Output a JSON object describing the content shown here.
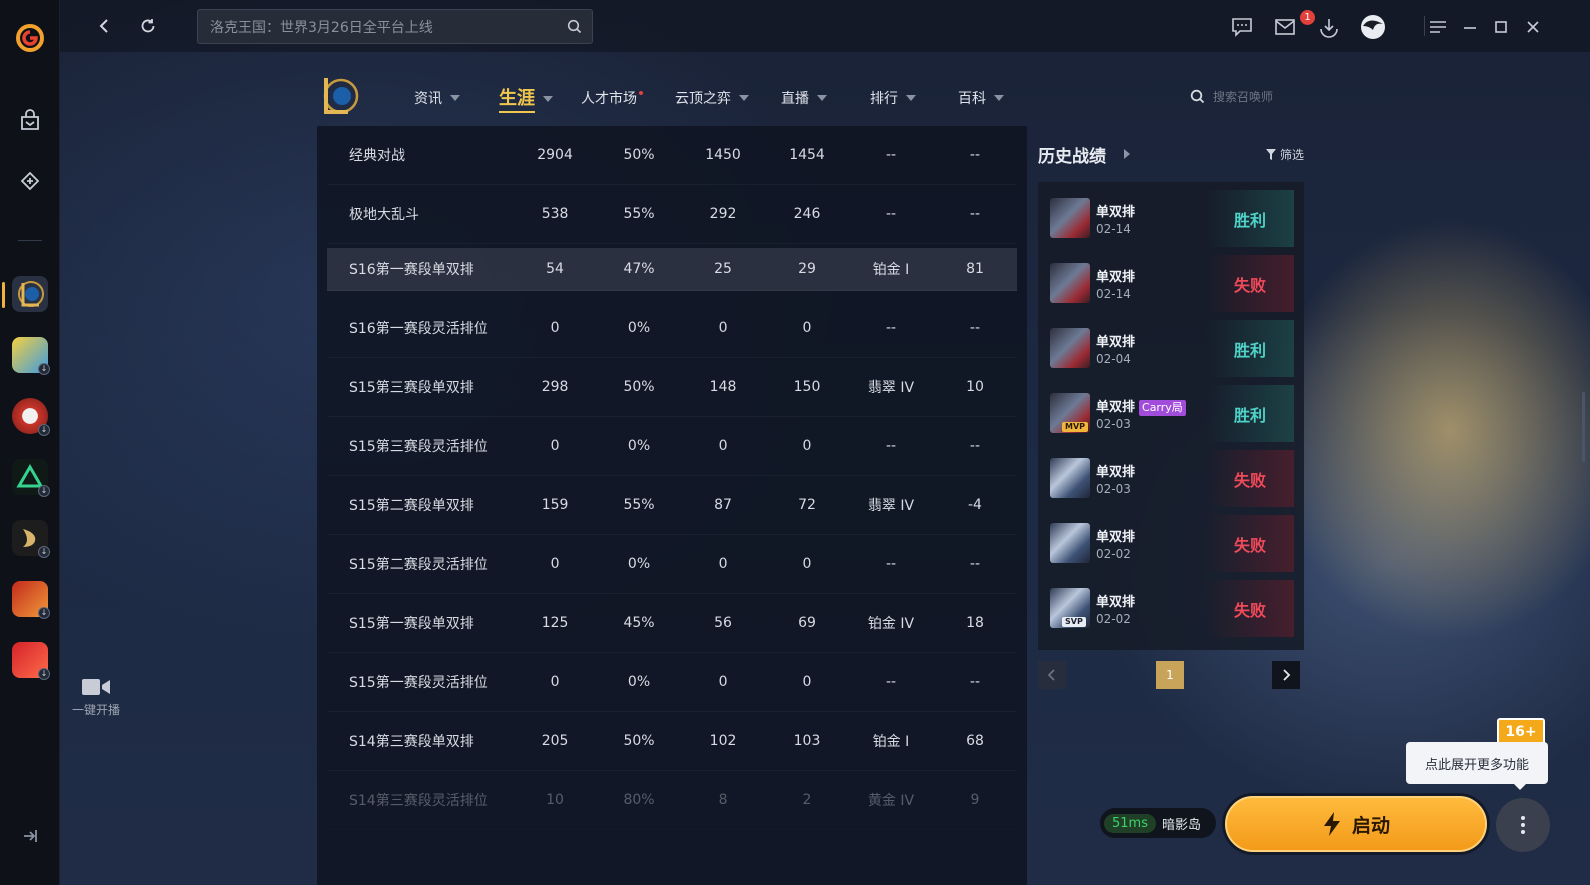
{
  "topbar": {
    "search_placeholder": "洛克王国：世界3月26日全平台上线",
    "mail_badge": "1"
  },
  "left_rail": {
    "live_label": "一键开播"
  },
  "game_nav": {
    "tabs": [
      {
        "label": "资讯"
      },
      {
        "label": "生涯"
      },
      {
        "label": "人才市场"
      },
      {
        "label": "云顶之弈"
      },
      {
        "label": "直播"
      },
      {
        "label": "排行"
      },
      {
        "label": "百科"
      }
    ],
    "search_placeholder": "搜索召唤师"
  },
  "stats_table": {
    "rows": [
      {
        "mode": "经典对战",
        "games": "2904",
        "winrate": "50%",
        "wins": "1450",
        "losses": "1454",
        "rank": "--",
        "points": "--"
      },
      {
        "mode": "极地大乱斗",
        "games": "538",
        "winrate": "55%",
        "wins": "292",
        "losses": "246",
        "rank": "--",
        "points": "--"
      },
      {
        "mode": "S16第一赛段单双排",
        "games": "54",
        "winrate": "47%",
        "wins": "25",
        "losses": "29",
        "rank": "铂金 I",
        "points": "81"
      },
      {
        "mode": "S16第一赛段灵活排位",
        "games": "0",
        "winrate": "0%",
        "wins": "0",
        "losses": "0",
        "rank": "--",
        "points": "--"
      },
      {
        "mode": "S15第三赛段单双排",
        "games": "298",
        "winrate": "50%",
        "wins": "148",
        "losses": "150",
        "rank": "翡翠 IV",
        "points": "10"
      },
      {
        "mode": "S15第三赛段灵活排位",
        "games": "0",
        "winrate": "0%",
        "wins": "0",
        "losses": "0",
        "rank": "--",
        "points": "--"
      },
      {
        "mode": "S15第二赛段单双排",
        "games": "159",
        "winrate": "55%",
        "wins": "87",
        "losses": "72",
        "rank": "翡翠 IV",
        "points": "-4"
      },
      {
        "mode": "S15第二赛段灵活排位",
        "games": "0",
        "winrate": "0%",
        "wins": "0",
        "losses": "0",
        "rank": "--",
        "points": "--"
      },
      {
        "mode": "S15第一赛段单双排",
        "games": "125",
        "winrate": "45%",
        "wins": "56",
        "losses": "69",
        "rank": "铂金 IV",
        "points": "18"
      },
      {
        "mode": "S15第一赛段灵活排位",
        "games": "0",
        "winrate": "0%",
        "wins": "0",
        "losses": "0",
        "rank": "--",
        "points": "--"
      },
      {
        "mode": "S14第三赛段单双排",
        "games": "205",
        "winrate": "50%",
        "wins": "102",
        "losses": "103",
        "rank": "铂金 I",
        "points": "68"
      },
      {
        "mode": "S14第三赛段灵活排位",
        "games": "10",
        "winrate": "80%",
        "wins": "8",
        "losses": "2",
        "rank": "黄金 IV",
        "points": "9"
      }
    ]
  },
  "history": {
    "title": "历史战绩",
    "filter_label": "筛选",
    "matches": [
      {
        "mode": "单双排",
        "date": "02-14",
        "result": "胜利",
        "outcome": "win",
        "champ": "red",
        "tag": "",
        "carry": ""
      },
      {
        "mode": "单双排",
        "date": "02-14",
        "result": "失败",
        "outcome": "lose",
        "champ": "red",
        "tag": "",
        "carry": ""
      },
      {
        "mode": "单双排",
        "date": "02-04",
        "result": "胜利",
        "outcome": "win",
        "champ": "red",
        "tag": "",
        "carry": ""
      },
      {
        "mode": "单双排",
        "date": "02-03",
        "result": "胜利",
        "outcome": "win",
        "champ": "red",
        "tag": "MVP",
        "carry": "Carry局"
      },
      {
        "mode": "单双排",
        "date": "02-03",
        "result": "失败",
        "outcome": "lose",
        "champ": "blue",
        "tag": "",
        "carry": ""
      },
      {
        "mode": "单双排",
        "date": "02-02",
        "result": "失败",
        "outcome": "lose",
        "champ": "blue",
        "tag": "",
        "carry": ""
      },
      {
        "mode": "单双排",
        "date": "02-02",
        "result": "失败",
        "outcome": "lose",
        "champ": "blue",
        "tag": "SVP",
        "carry": ""
      }
    ],
    "current_page": "1"
  },
  "bottom": {
    "ping": "51ms",
    "server": "暗影岛",
    "launch_label": "启动",
    "tooltip": "点此展开更多功能",
    "age_rating": "16+"
  },
  "colors": {
    "accent": "#f1c64f",
    "win": "#4fd2c8",
    "lose": "#ef4a5a",
    "launch": "#f39a1a"
  }
}
